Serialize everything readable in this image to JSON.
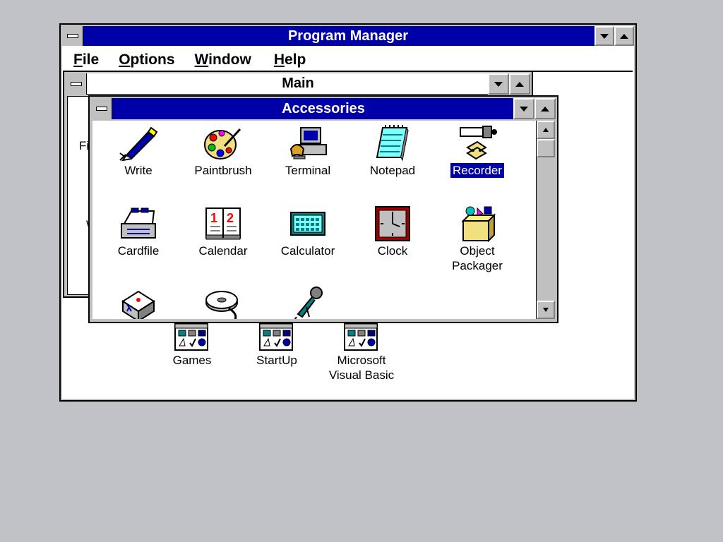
{
  "program_manager": {
    "title": "Program Manager",
    "menu": [
      {
        "underline": "F",
        "rest": "ile"
      },
      {
        "underline": "O",
        "rest": "ptions"
      },
      {
        "underline": "W",
        "rest": "indow"
      },
      {
        "underline": "H",
        "rest": "elp"
      }
    ]
  },
  "main_window": {
    "title": "Main",
    "clipped_labels": [
      "Fi",
      "W"
    ]
  },
  "accessories": {
    "title": "Accessories",
    "items": [
      {
        "label": "Write",
        "icon": "write-icon"
      },
      {
        "label": "Paintbrush",
        "icon": "paintbrush-icon"
      },
      {
        "label": "Terminal",
        "icon": "terminal-icon"
      },
      {
        "label": "Notepad",
        "icon": "notepad-icon"
      },
      {
        "label": "Recorder",
        "icon": "recorder-icon",
        "selected": true
      },
      {
        "label": "Cardfile",
        "icon": "cardfile-icon"
      },
      {
        "label": "Calendar",
        "icon": "calendar-icon"
      },
      {
        "label": "Calculator",
        "icon": "calculator-icon"
      },
      {
        "label": "Clock",
        "icon": "clock-icon"
      },
      {
        "label_line1": "Object",
        "label_line2": "Packager",
        "icon": "object-packager-icon"
      },
      {
        "label": "",
        "icon": "pif-editor-icon"
      },
      {
        "label": "",
        "icon": "media-player-icon"
      },
      {
        "label": "",
        "icon": "sound-recorder-icon"
      }
    ]
  },
  "group_icons": [
    {
      "label": "Games",
      "icon": "program-group-icon"
    },
    {
      "label": "StartUp",
      "icon": "program-group-icon"
    },
    {
      "label_line1": "Microsoft",
      "label_line2": "Visual Basic",
      "icon": "program-group-icon"
    }
  ],
  "calendar_digits": [
    "1",
    "2"
  ],
  "colors": {
    "title_active": "#0000a8",
    "desktop": "#c0c2c7",
    "selection": "#0000a8"
  }
}
